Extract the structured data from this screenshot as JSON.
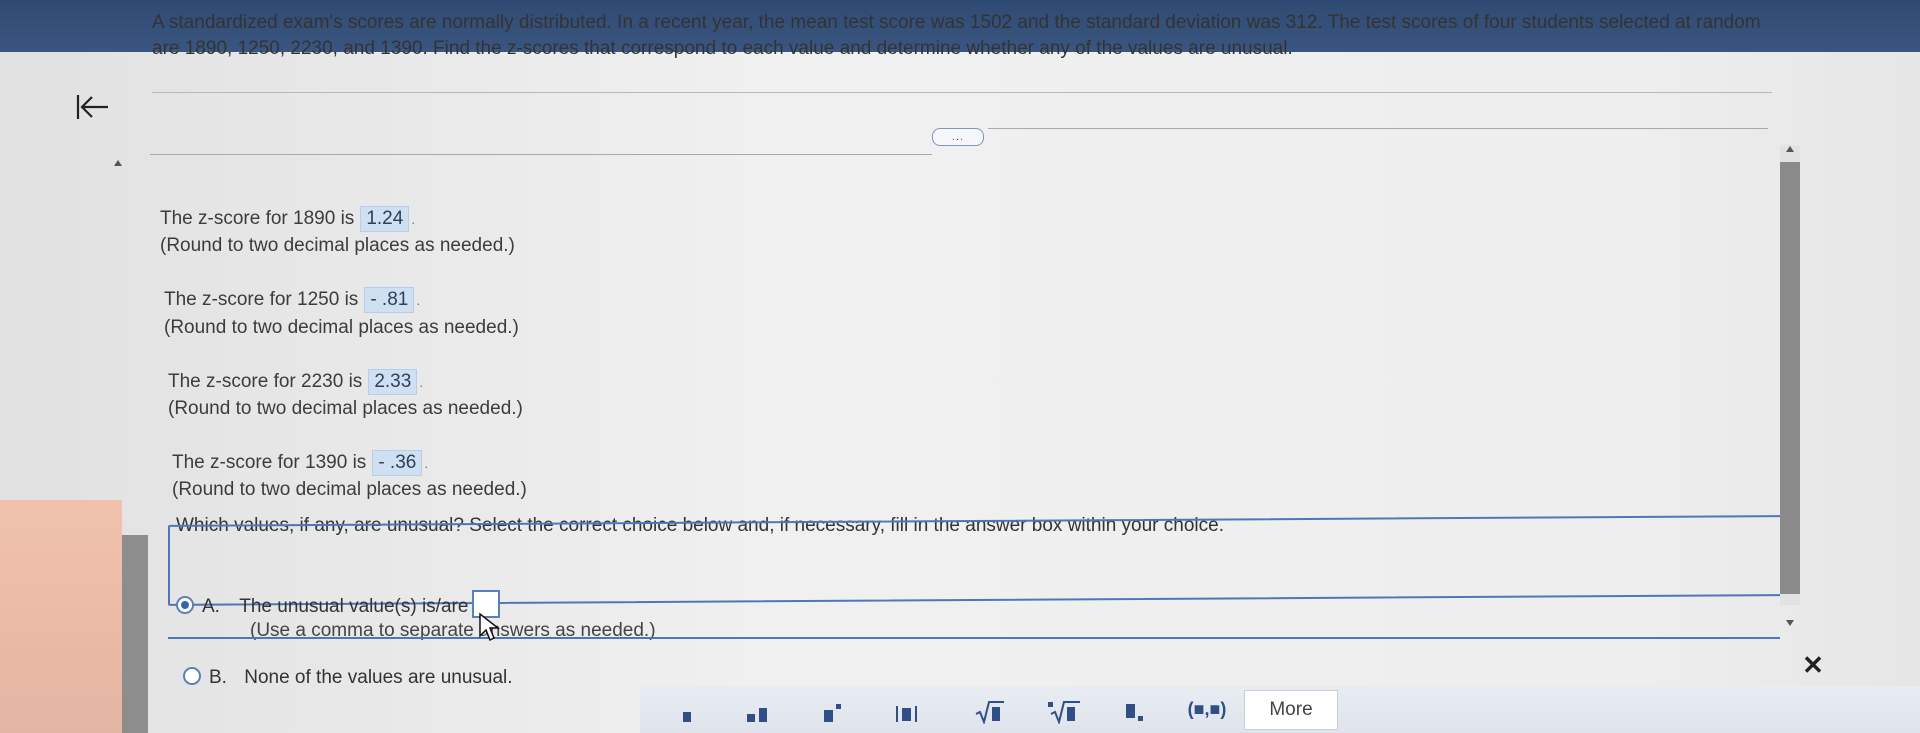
{
  "question": {
    "text": "A standardized exam's scores are normally distributed. In a recent year, the mean test score was 1502 and the standard deviation was 312. The test scores of four students selected at random are 1890, 1250, 2230, and 1390. Find the z-scores that correspond to each value and determine whether any of the values are unusual."
  },
  "more_pill": "...",
  "zscores": [
    {
      "label": "The z-score for 1890 is",
      "value": "1.24",
      "period": ".",
      "hint": "(Round to two decimal places as needed.)"
    },
    {
      "label": "The z-score for 1250 is",
      "value": "- .81",
      "period": ".",
      "hint": "(Round to two decimal places as needed.)"
    },
    {
      "label": "The z-score for 2230 is",
      "value": "2.33",
      "period": ".",
      "hint": "(Round to two decimal places as needed.)"
    },
    {
      "label": "The z-score for 1390 is",
      "value": "- .36",
      "period": ".",
      "hint": "(Round to two decimal places as needed.)"
    }
  ],
  "choice_prompt": "Which values, if any, are unusual? Select the correct choice below and, if necessary, fill in the answer box within your choice.",
  "choice_a": {
    "letter": "A.",
    "text": "The unusual value(s) is/are",
    "note": "(Use a comma to separate answers as needed.)",
    "selected": true
  },
  "choice_b": {
    "letter": "B.",
    "text": "None of the values are unusual.",
    "selected": false
  },
  "toolbar": {
    "more_label": "More",
    "tools": [
      "fraction-icon",
      "mixed-number-icon",
      "exponent-icon",
      "absolute-value-icon",
      "sqrt-icon",
      "nth-root-icon",
      "subscript-icon",
      "ordered-pair-icon"
    ],
    "ordered_pair_label": "(■,■)"
  },
  "colors": {
    "topbar": "#2f4a72",
    "answer_bg": "#cfe0f3",
    "choice_border": "#4e77b8",
    "accent": "#3466b0"
  }
}
